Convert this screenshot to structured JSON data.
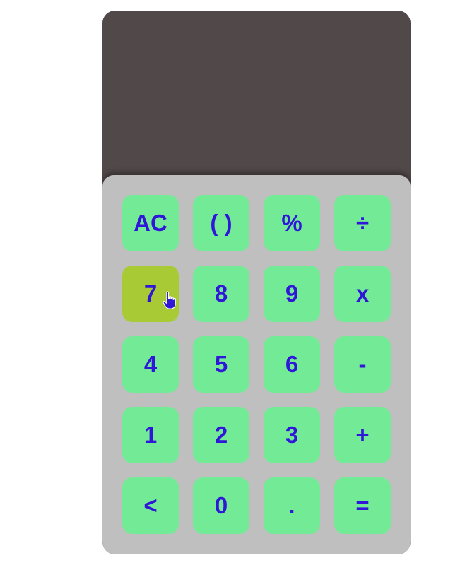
{
  "display": {
    "value": ""
  },
  "keys": [
    {
      "label": "AC",
      "hover": false
    },
    {
      "label": "( )",
      "hover": false
    },
    {
      "label": "%",
      "hover": false
    },
    {
      "label": "÷",
      "hover": false
    },
    {
      "label": "7",
      "hover": true
    },
    {
      "label": "8",
      "hover": false
    },
    {
      "label": "9",
      "hover": false
    },
    {
      "label": "x",
      "hover": false
    },
    {
      "label": "4",
      "hover": false
    },
    {
      "label": "5",
      "hover": false
    },
    {
      "label": "6",
      "hover": false
    },
    {
      "label": "-",
      "hover": false
    },
    {
      "label": "1",
      "hover": false
    },
    {
      "label": "2",
      "hover": false
    },
    {
      "label": "3",
      "hover": false
    },
    {
      "label": "+",
      "hover": false
    },
    {
      "label": "<",
      "hover": false
    },
    {
      "label": "0",
      "hover": false
    },
    {
      "label": ".",
      "hover": false
    },
    {
      "label": "=",
      "hover": false
    }
  ],
  "colors": {
    "display_bg": "#514849",
    "keypad_bg": "#c0bfc0",
    "key_bg": "#73ea96",
    "key_hover_bg": "#a8ca35",
    "key_text": "#2f16d8"
  },
  "cursor": {
    "icon": "hand-pointer-icon"
  }
}
